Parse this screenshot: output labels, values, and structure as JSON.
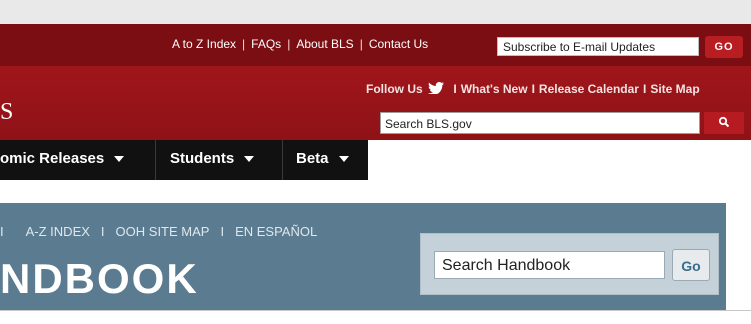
{
  "top_links": {
    "a_to_z": "A to Z Index",
    "faqs": "FAQs",
    "about": "About BLS",
    "contact": "Contact Us",
    "separator": "|"
  },
  "subscribe": {
    "value": "Subscribe to E-mail Updates",
    "button": "GO"
  },
  "social": {
    "follow_label": "Follow Us",
    "whats_new": "What's New",
    "release_calendar": "Release Calendar",
    "site_map": "Site Map",
    "separator": "I"
  },
  "logo_fragment": "S",
  "bls_search": {
    "value": "Search BLS.gov",
    "button_icon": "search-icon"
  },
  "nav": {
    "economic_releases": "omic Releases",
    "students": "Students",
    "beta": "Beta"
  },
  "handbook": {
    "nav_sep": "I",
    "az_index": "A-Z INDEX",
    "site_map": "OOH SITE MAP",
    "espanol": "EN ESPAÑOL",
    "title_fragment": "NDBOOK",
    "search_value": "Search Handbook",
    "go_button": "Go"
  },
  "colors": {
    "header_red": "#a8181c",
    "top_dark_red": "#7b0e12",
    "nav_black": "#111111",
    "handbook_blue": "#5b7b90"
  }
}
